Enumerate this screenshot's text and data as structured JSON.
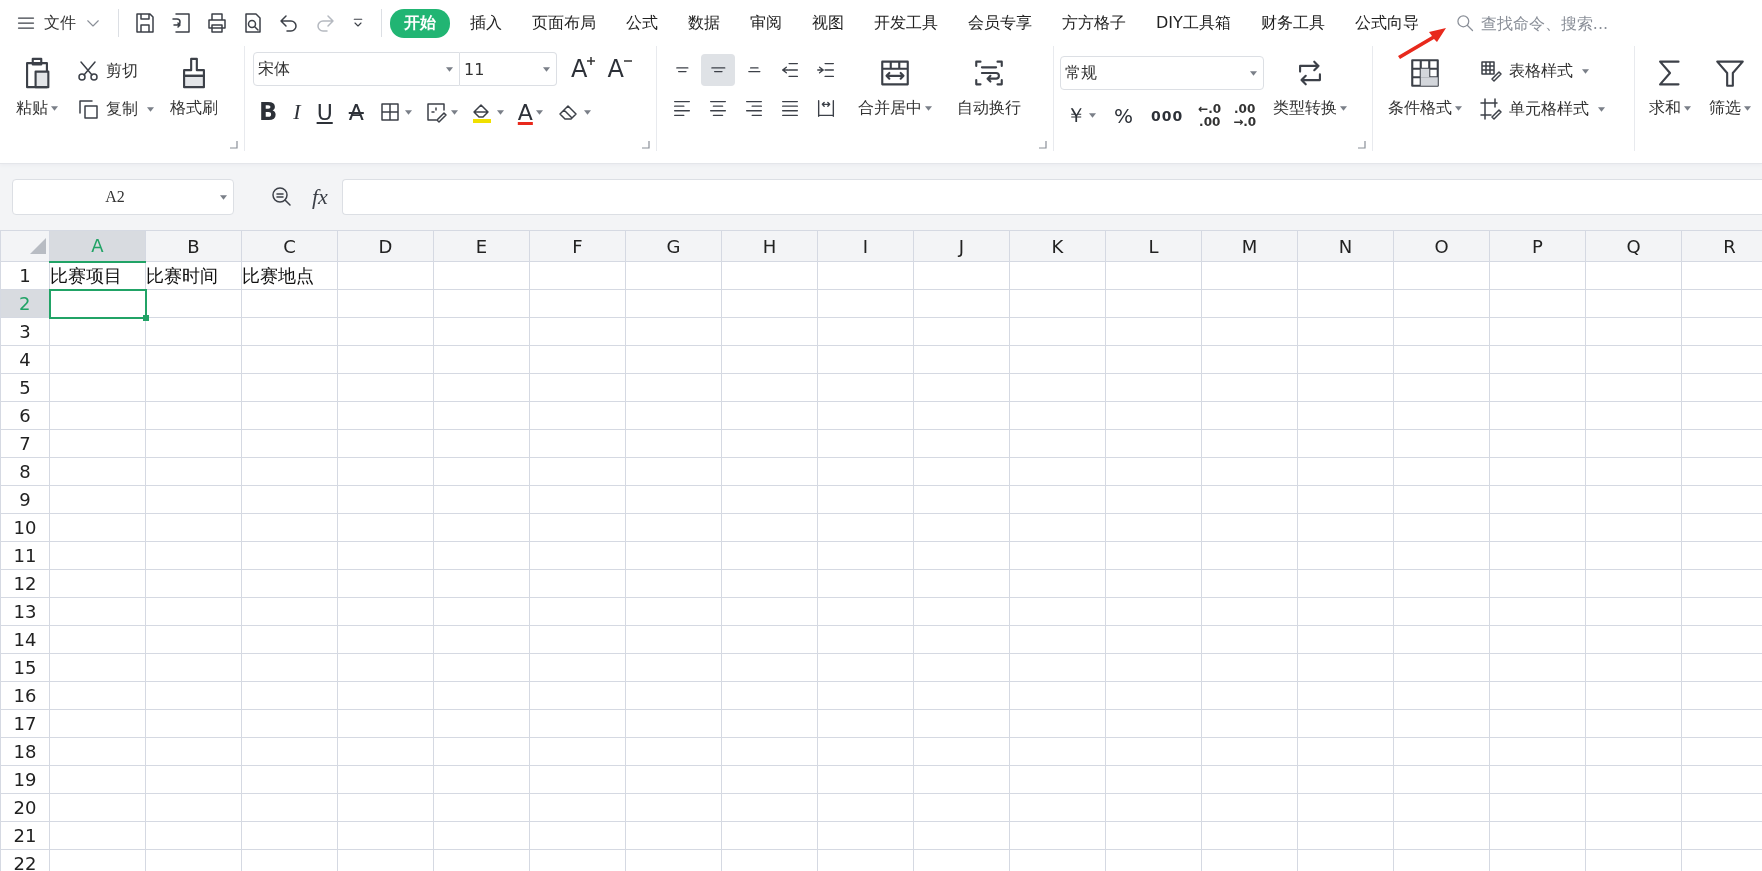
{
  "menu_bar": {
    "file_menu": "文件",
    "tabs": [
      {
        "label": "开始",
        "selected": true
      },
      {
        "label": "插入",
        "selected": false
      },
      {
        "label": "页面布局",
        "selected": false
      },
      {
        "label": "公式",
        "selected": false
      },
      {
        "label": "数据",
        "selected": false
      },
      {
        "label": "审阅",
        "selected": false
      },
      {
        "label": "视图",
        "selected": false
      },
      {
        "label": "开发工具",
        "selected": false
      },
      {
        "label": "会员专享",
        "selected": false
      },
      {
        "label": "方方格子",
        "selected": false
      },
      {
        "label": "DIY工具箱",
        "selected": false
      },
      {
        "label": "财务工具",
        "selected": false
      },
      {
        "label": "公式向导",
        "selected": false
      }
    ],
    "search": {
      "placeholder": "查找命令、搜索..."
    }
  },
  "ribbon": {
    "clipboard": {
      "paste": "粘贴",
      "cut": "剪切",
      "copy": "复制",
      "format_painter": "格式刷"
    },
    "font": {
      "name": "宋体",
      "size": "11",
      "grow": "A",
      "shrink": "A",
      "styles": [
        "B",
        "I",
        "U",
        "A"
      ],
      "font_color": "A"
    },
    "alignment": {
      "vertical": [
        {
          "selected": false
        },
        {
          "selected": true
        },
        {
          "selected": false
        }
      ],
      "merge": "合并居中",
      "wrap": "自动换行"
    },
    "number": {
      "format": "常规",
      "currency": "￥",
      "percent": "%",
      "thousands": "000",
      "decimal_more": [
        "←.0",
        ".00"
      ],
      "decimal_less": [
        ".00",
        "→.0"
      ],
      "convert": "类型转换"
    },
    "styles": {
      "conditional": "条件格式",
      "table_style": "表格样式",
      "cell_style": "单元格样式"
    },
    "editing": {
      "sum": "求和",
      "filter": "筛选"
    }
  },
  "formula_bar": {
    "name_box": "A2",
    "fx": "fx"
  },
  "sheet": {
    "columns": [
      {
        "label": "A",
        "selected": true
      },
      {
        "label": "B",
        "selected": false
      },
      {
        "label": "C",
        "selected": false
      },
      {
        "label": "D",
        "selected": false
      },
      {
        "label": "E",
        "selected": false
      },
      {
        "label": "F",
        "selected": false
      },
      {
        "label": "G",
        "selected": false
      },
      {
        "label": "H",
        "selected": false
      },
      {
        "label": "I",
        "selected": false
      },
      {
        "label": "J",
        "selected": false
      },
      {
        "label": "K",
        "selected": false
      },
      {
        "label": "L",
        "selected": false
      },
      {
        "label": "M",
        "selected": false
      },
      {
        "label": "N",
        "selected": false
      },
      {
        "label": "O",
        "selected": false
      },
      {
        "label": "P",
        "selected": false
      },
      {
        "label": "Q",
        "selected": false
      },
      {
        "label": "R",
        "selected": false
      }
    ],
    "rows": [
      {
        "label": "1",
        "selected": false,
        "cells": [
          "比赛项目",
          "比赛时间",
          "比赛地点"
        ]
      },
      {
        "label": "2",
        "selected": true
      },
      {
        "label": "3",
        "selected": false
      },
      {
        "label": "4",
        "selected": false
      },
      {
        "label": "5",
        "selected": false
      },
      {
        "label": "6",
        "selected": false
      },
      {
        "label": "7",
        "selected": false
      },
      {
        "label": "8",
        "selected": false
      },
      {
        "label": "9",
        "selected": false
      },
      {
        "label": "10",
        "selected": false
      },
      {
        "label": "11",
        "selected": false
      },
      {
        "label": "12",
        "selected": false
      },
      {
        "label": "13",
        "selected": false
      },
      {
        "label": "14",
        "selected": false
      },
      {
        "label": "15",
        "selected": false
      },
      {
        "label": "16",
        "selected": false
      },
      {
        "label": "17",
        "selected": false
      },
      {
        "label": "18",
        "selected": false
      },
      {
        "label": "19",
        "selected": false
      },
      {
        "label": "20",
        "selected": false
      },
      {
        "label": "21",
        "selected": false
      },
      {
        "label": "22",
        "selected": false
      }
    ]
  }
}
